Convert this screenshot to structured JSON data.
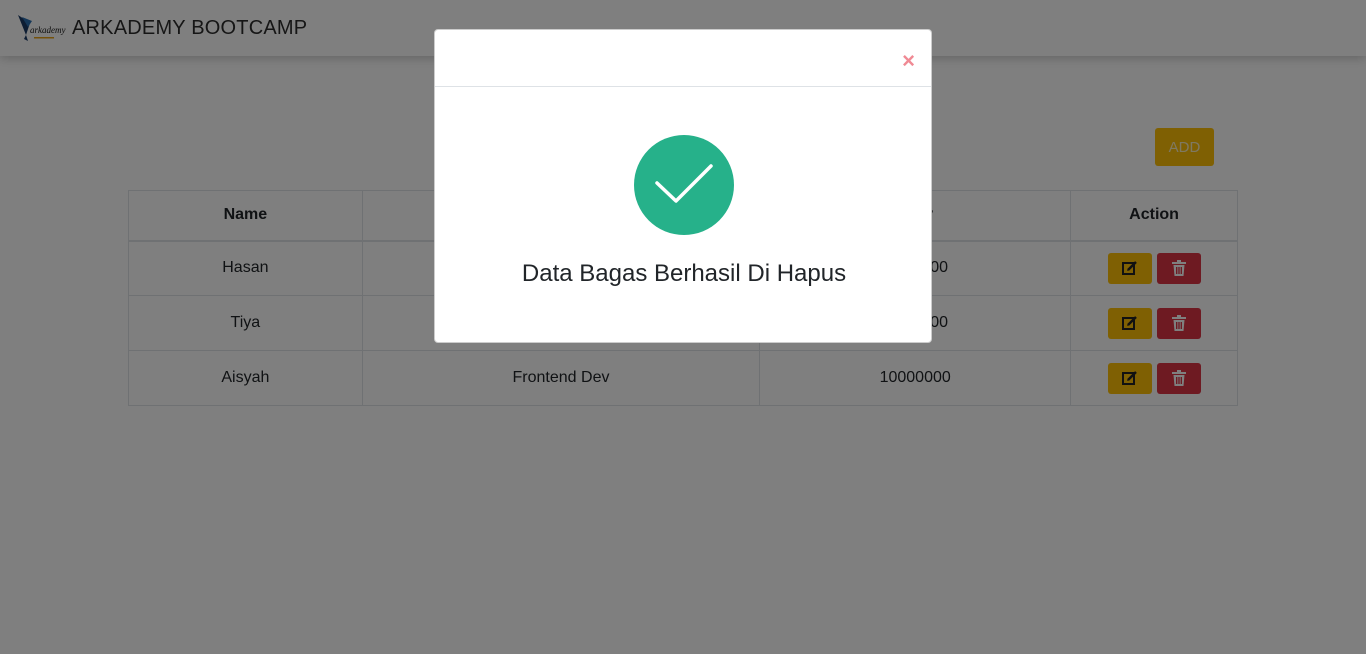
{
  "navbar": {
    "brand": "ARKADEMY BOOTCAMP",
    "logo_text": "arkademy"
  },
  "toolbar": {
    "add_label": "ADD"
  },
  "table": {
    "headers": {
      "name": "Name",
      "salary": "y",
      "action": "Action"
    },
    "rows": [
      {
        "name": "Hasan",
        "job": "",
        "salary": "00"
      },
      {
        "name": "Tiya",
        "job": "",
        "salary": "00"
      },
      {
        "name": "Aisyah",
        "job": "Frontend Dev",
        "salary": "10000000"
      }
    ]
  },
  "modal": {
    "close_symbol": "×",
    "message": "Data Bagas Berhasil Di Hapus",
    "icon": "check-icon"
  },
  "colors": {
    "warning": "#ffc107",
    "danger": "#dc3545",
    "success": "#26b18a",
    "backdrop": "rgba(0,0,0,0.5)"
  }
}
